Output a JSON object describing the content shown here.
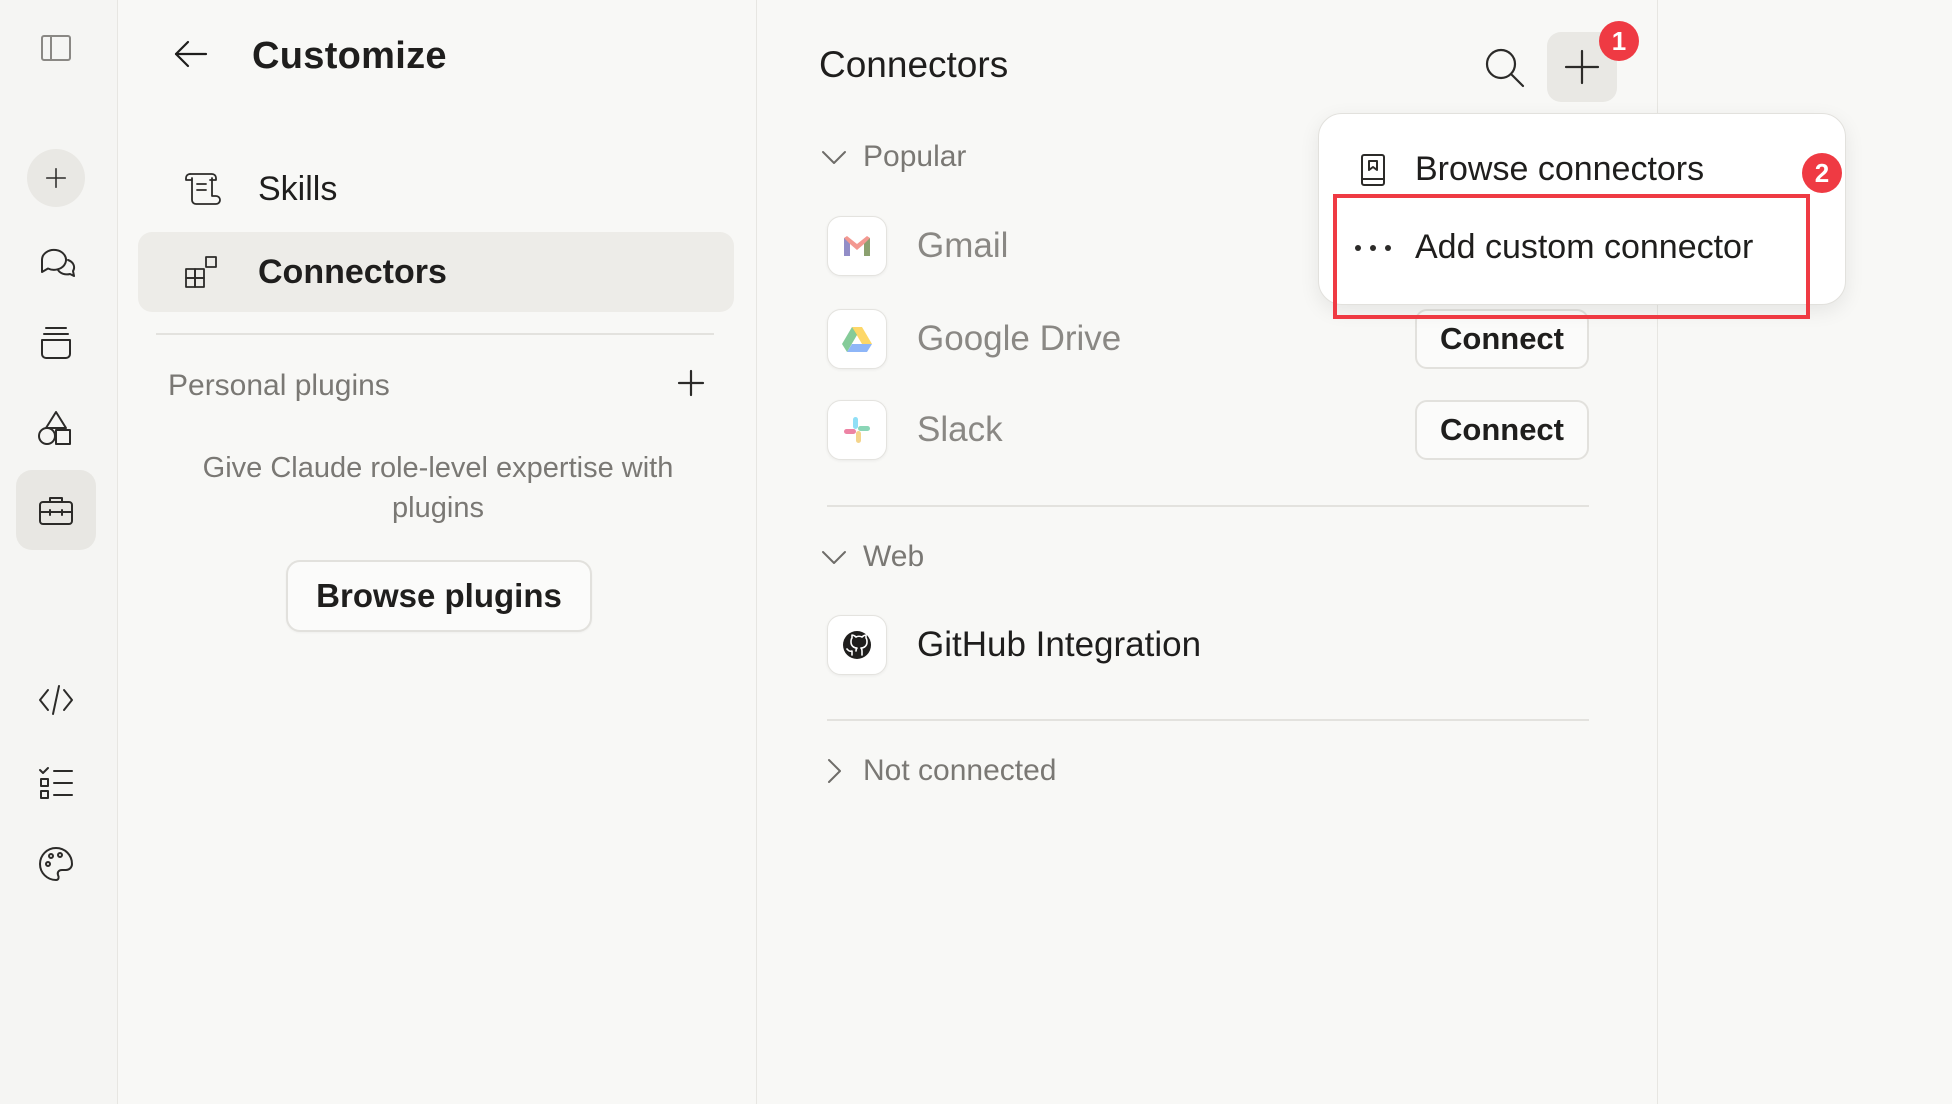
{
  "rail": {
    "items": [
      {
        "name": "sidebar-toggle-icon"
      },
      {
        "name": "new-chat-icon"
      },
      {
        "name": "chats-icon"
      },
      {
        "name": "projects-icon"
      },
      {
        "name": "artifacts-icon"
      },
      {
        "name": "customize-icon"
      },
      {
        "name": "code-icon"
      },
      {
        "name": "tasks-icon"
      },
      {
        "name": "palette-icon"
      }
    ]
  },
  "sidebar": {
    "title": "Customize",
    "nav": [
      {
        "label": "Skills",
        "icon": "scroll-icon"
      },
      {
        "label": "Connectors",
        "icon": "connectors-icon",
        "active": true
      }
    ],
    "plugins_label": "Personal plugins",
    "plugins_description": "Give Claude role-level expertise with plugins",
    "browse_plugins": "Browse plugins"
  },
  "main": {
    "title": "Connectors",
    "sections": {
      "popular": "Popular",
      "web": "Web",
      "not_connected": "Not connected"
    },
    "popular_connectors": [
      {
        "name": "Gmail",
        "action": ""
      },
      {
        "name": "Google Drive",
        "action": "Connect"
      },
      {
        "name": "Slack",
        "action": "Connect"
      }
    ],
    "web_connectors": [
      {
        "name": "GitHub Integration"
      }
    ]
  },
  "dropdown": {
    "items": [
      {
        "label": "Browse connectors",
        "icon": "book-icon"
      },
      {
        "label": "Add custom connector",
        "icon": "more-dots-icon"
      }
    ]
  },
  "annotations": {
    "badge1": "1",
    "badge2": "2",
    "highlight_color": "#ef3a43"
  },
  "colors": {
    "background": "#f8f8f6",
    "text": "#1f1e1d",
    "muted_text": "#7a7874",
    "accent_red": "#ef3a43"
  }
}
